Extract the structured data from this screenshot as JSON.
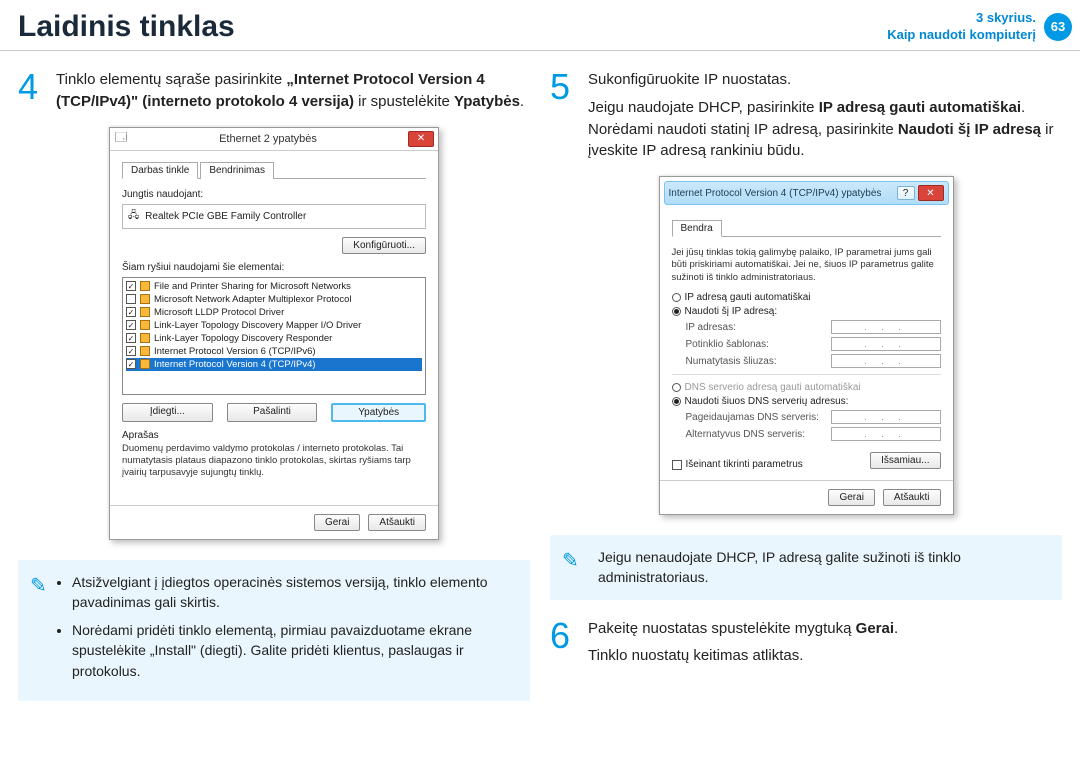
{
  "header": {
    "title": "Laidinis tinklas",
    "chapter_line1": "3 skyrius.",
    "chapter_line2": "Kaip naudoti kompiuterį",
    "page": "63"
  },
  "step4": {
    "num": "4",
    "text_pre": "Tinklo elementų sąraše pasirinkite ",
    "text_bold1": "„Internet Protocol Version 4 (TCP/IPv4)\" (interneto protokolo 4 versija)",
    "text_mid": " ir spustelėkite ",
    "text_bold2": "Ypatybės",
    "text_post": "."
  },
  "dialog1": {
    "title": "Ethernet 2 ypatybės",
    "close": "✕",
    "tabs": {
      "t1": "Darbas tinkle",
      "t2": "Bendrinimas"
    },
    "connect_using_lbl": "Jungtis naudojant:",
    "adapter": "Realtek PCIe GBE Family Controller",
    "configure_btn": "Konfigūruoti...",
    "items_lbl": "Šiam ryšiui naudojami šie elementai:",
    "items": [
      {
        "checked": true,
        "label": "File and Printer Sharing for Microsoft Networks"
      },
      {
        "checked": false,
        "label": "Microsoft Network Adapter Multiplexor Protocol"
      },
      {
        "checked": true,
        "label": "Microsoft LLDP Protocol Driver"
      },
      {
        "checked": true,
        "label": "Link-Layer Topology Discovery Mapper I/O Driver"
      },
      {
        "checked": true,
        "label": "Link-Layer Topology Discovery Responder"
      },
      {
        "checked": true,
        "label": "Internet Protocol Version 6 (TCP/IPv6)"
      },
      {
        "checked": true,
        "label": "Internet Protocol Version 4 (TCP/IPv4)",
        "selected": true
      }
    ],
    "install_btn": "Įdiegti...",
    "uninstall_btn": "Pašalinti",
    "properties_btn": "Ypatybės",
    "desc_lbl": "Aprašas",
    "desc_text": "Duomenų perdavimo valdymo protokolas / interneto protokolas. Tai numatytasis plataus diapazono tinklo protokolas, skirtas ryšiams tarp įvairių tarpusavyje sujungtų tinklų.",
    "ok": "Gerai",
    "cancel": "Atšaukti"
  },
  "note_left": {
    "b1": "Atsižvelgiant į įdiegtos operacinės sistemos versiją, tinklo elemento pavadinimas gali skirtis.",
    "b2": "Norėdami pridėti tinklo elementą, pirmiau pavaizduotame ekrane spustelėkite „Install\" (diegti). Galite pridėti klientus, paslaugas ir protokolus."
  },
  "step5": {
    "num": "5",
    "line1": "Sukonfigūruokite IP nuostatas.",
    "line2_pre": "Jeigu naudojate DHCP, pasirinkite ",
    "line2_b1": "IP adresą gauti automatiškai",
    "line2_mid": ". Norėdami naudoti statinį IP adresą, pasirinkite ",
    "line2_b2": "Naudoti šį IP adresą",
    "line2_post": " ir įveskite IP adresą rankiniu būdu."
  },
  "dialog2": {
    "title": "Internet Protocol Version 4 (TCP/IPv4) ypatybės",
    "help": "?",
    "close": "✕",
    "tab": "Bendra",
    "intro": "Jei jūsų tinklas tokią galimybę palaiko, IP parametrai jums gali būti priskiriami automatiškai. Jei ne, šiuos IP parametrus galite sužinoti iš tinklo administratoriaus.",
    "r1": "IP adresą gauti automatiškai",
    "r2": "Naudoti šį IP adresą:",
    "ip_lbl": "IP adresas:",
    "mask_lbl": "Potinklio šablonas:",
    "gw_lbl": "Numatytasis šliuzas:",
    "r3": "DNS serverio adresą gauti automatiškai",
    "r4": "Naudoti šiuos DNS serverių adresus:",
    "dns1_lbl": "Pageidaujamas DNS serveris:",
    "dns2_lbl": "Alternatyvus DNS serveris:",
    "validate": "Išeinant tikrinti parametrus",
    "advanced": "Išsamiau...",
    "ip_placeholder": ". . .",
    "ok": "Gerai",
    "cancel": "Atšaukti"
  },
  "note_right": {
    "text": "Jeigu nenaudojate DHCP, IP adresą galite sužinoti iš tinklo administratoriaus."
  },
  "step6": {
    "num": "6",
    "line1_pre": "Pakeitę nuostatas spustelėkite mygtuką ",
    "line1_b": "Gerai",
    "line1_post": ".",
    "line2": "Tinklo nuostatų keitimas atliktas."
  }
}
